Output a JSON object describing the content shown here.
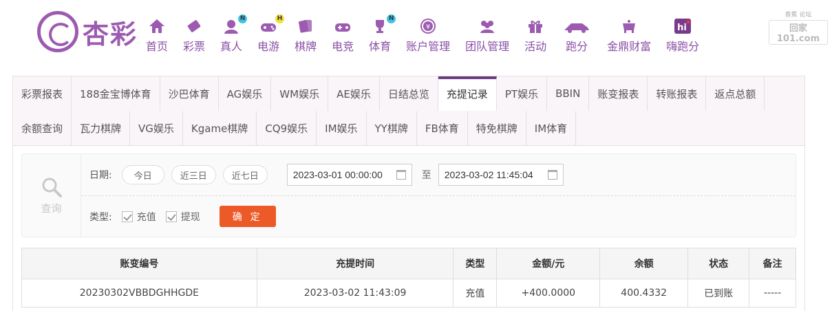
{
  "brand": {
    "logo_text": "杏彩"
  },
  "nav": [
    {
      "label": "首页",
      "icon": "home-icon",
      "badge": ""
    },
    {
      "label": "彩票",
      "icon": "ticket-icon",
      "badge": ""
    },
    {
      "label": "真人",
      "icon": "dealer-icon",
      "badge": "N"
    },
    {
      "label": "电游",
      "icon": "gamepad-icon",
      "badge": "H"
    },
    {
      "label": "棋牌",
      "icon": "cards-icon",
      "badge": ""
    },
    {
      "label": "电竞",
      "icon": "controller-icon",
      "badge": ""
    },
    {
      "label": "体育",
      "icon": "trophy-icon",
      "badge": "N"
    },
    {
      "label": "账户管理",
      "icon": "yen-coin-icon",
      "badge": ""
    },
    {
      "label": "团队管理",
      "icon": "team-icon",
      "badge": ""
    },
    {
      "label": "活动",
      "icon": "gift-icon",
      "badge": ""
    },
    {
      "label": "跑分",
      "icon": "runner-icon",
      "badge": ""
    },
    {
      "label": "金鼎财富",
      "icon": "cauldron-icon",
      "badge": ""
    },
    {
      "label": "嗨跑分",
      "icon": "hi-icon",
      "badge": ""
    }
  ],
  "watermark": {
    "top": "香蕉 论坛",
    "main": "回家101.com"
  },
  "tabs_row1": [
    "彩票报表",
    "188金宝博体育",
    "沙巴体育",
    "AG娱乐",
    "WM娱乐",
    "AE娱乐",
    "日结总览",
    "充提记录",
    "PT娱乐",
    "BBIN",
    "账变报表",
    "转账报表",
    "返点总额"
  ],
  "tabs_row2": [
    "余额查询",
    "瓦力棋牌",
    "VG娱乐",
    "Kgame棋牌",
    "CQ9娱乐",
    "IM娱乐",
    "YY棋牌",
    "FB体育",
    "特免棋牌",
    "IM体育"
  ],
  "active_tab": "充提记录",
  "search": {
    "side_label": "查询",
    "date_label": "日期:",
    "quick_ranges": [
      "今日",
      "近三日",
      "近七日"
    ],
    "start": "2023-03-01 00:00:00",
    "to_label": "至",
    "end": "2023-03-02 11:45:04",
    "type_label": "类型:",
    "types": [
      "充值",
      "提现"
    ],
    "confirm_label": "确 定"
  },
  "table": {
    "headers": [
      "账变编号",
      "充提时间",
      "类型",
      "金额/元",
      "余额",
      "状态",
      "备注"
    ],
    "rows": [
      [
        "20230302VBBDGHHGDE",
        "2023-03-02 11:43:09",
        "充值",
        "+400.0000",
        "400.4332",
        "已到账",
        "-----"
      ]
    ]
  },
  "colors": {
    "brand": "#8a4fa6",
    "confirm": "#ec5a28",
    "amount": "#d0262c",
    "status": "#2e9e3a"
  }
}
